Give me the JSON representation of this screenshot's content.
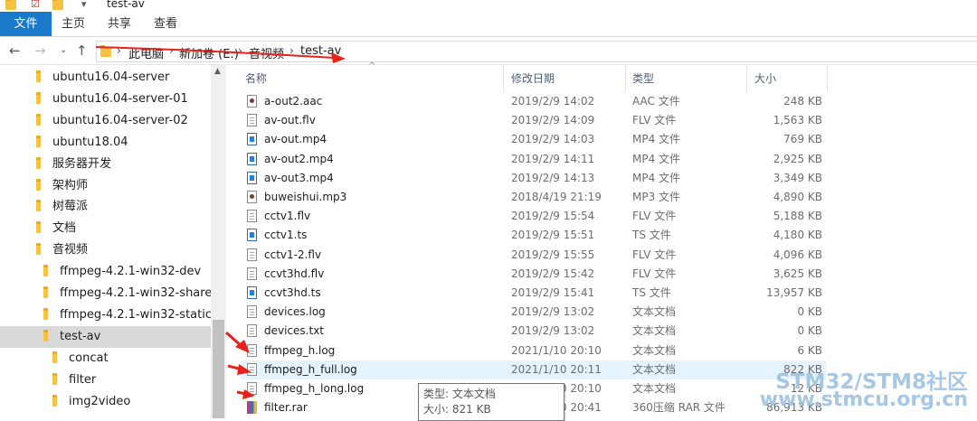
{
  "window": {
    "title": "test-av"
  },
  "ribbon": {
    "tabs": [
      "文件",
      "主页",
      "共享",
      "查看"
    ],
    "active": 0,
    "accent": "#1979ca"
  },
  "nav": {
    "back_icon": "arrow-left-icon",
    "forward_icon": "arrow-right-icon",
    "recent_icon": "chevron-down-icon",
    "up_icon": "arrow-up-icon"
  },
  "address": {
    "crumbs": [
      "此电脑",
      "新加卷 (E:)",
      "音视频",
      "test-av"
    ]
  },
  "sidebar": {
    "items": [
      {
        "label": "ubuntu16.04-server"
      },
      {
        "label": "ubuntu16.04-server-01"
      },
      {
        "label": "ubuntu16.04-server-02"
      },
      {
        "label": "ubuntu18.04"
      },
      {
        "label": "服务器开发"
      },
      {
        "label": "架构师"
      },
      {
        "label": "树莓派"
      },
      {
        "label": "文档"
      },
      {
        "label": "音视频"
      },
      {
        "label": "ffmpeg-4.2.1-win32-dev"
      },
      {
        "label": "ffmpeg-4.2.1-win32-shared"
      },
      {
        "label": "ffmpeg-4.2.1-win32-static"
      },
      {
        "label": "test-av"
      },
      {
        "label": "concat"
      },
      {
        "label": "filter"
      },
      {
        "label": "img2video"
      }
    ],
    "selected": 12
  },
  "columns": {
    "name": "名称",
    "date": "修改日期",
    "type": "类型",
    "size": "大小"
  },
  "files": [
    {
      "name": "a-out2.aac",
      "date": "2019/2/9 14:02",
      "type": "AAC 文件",
      "size": "248 KB",
      "icon": "media"
    },
    {
      "name": "av-out.flv",
      "date": "2019/2/9 14:09",
      "type": "FLV 文件",
      "size": "1,563 KB",
      "icon": "text"
    },
    {
      "name": "av-out.mp4",
      "date": "2019/2/9 14:03",
      "type": "MP4 文件",
      "size": "769 KB",
      "icon": "video"
    },
    {
      "name": "av-out2.mp4",
      "date": "2019/2/9 14:11",
      "type": "MP4 文件",
      "size": "2,925 KB",
      "icon": "video"
    },
    {
      "name": "av-out3.mp4",
      "date": "2019/2/9 14:13",
      "type": "MP4 文件",
      "size": "3,349 KB",
      "icon": "video"
    },
    {
      "name": "buweishui.mp3",
      "date": "2018/4/19 21:19",
      "type": "MP3 文件",
      "size": "4,890 KB",
      "icon": "media"
    },
    {
      "name": "cctv1.flv",
      "date": "2019/2/9 15:54",
      "type": "FLV 文件",
      "size": "5,188 KB",
      "icon": "text"
    },
    {
      "name": "cctv1.ts",
      "date": "2019/2/9 15:51",
      "type": "TS 文件",
      "size": "4,180 KB",
      "icon": "video"
    },
    {
      "name": "cctv1-2.flv",
      "date": "2019/2/9 15:55",
      "type": "FLV 文件",
      "size": "4,096 KB",
      "icon": "text"
    },
    {
      "name": "ccvt3hd.flv",
      "date": "2019/2/9 15:42",
      "type": "FLV 文件",
      "size": "3,625 KB",
      "icon": "text"
    },
    {
      "name": "ccvt3hd.ts",
      "date": "2019/2/9 15:41",
      "type": "TS 文件",
      "size": "13,957 KB",
      "icon": "video"
    },
    {
      "name": "devices.log",
      "date": "2019/2/9 13:02",
      "type": "文本文档",
      "size": "0 KB",
      "icon": "text"
    },
    {
      "name": "devices.txt",
      "date": "2019/2/9 13:02",
      "type": "文本文档",
      "size": "0 KB",
      "icon": "text"
    },
    {
      "name": "ffmpeg_h.log",
      "date": "2021/1/10 20:10",
      "type": "文本文档",
      "size": "6 KB",
      "icon": "text"
    },
    {
      "name": "ffmpeg_h_full.log",
      "date": "2021/1/10 20:11",
      "type": "文本文档",
      "size": "822 KB",
      "icon": "text"
    },
    {
      "name": "ffmpeg_h_long.log",
      "date": "2021/1/10 20:10",
      "type": "文本文档",
      "size": "12 KB",
      "icon": "text"
    },
    {
      "name": "filter.rar",
      "date": "2021/1/10 20:41",
      "type": "360压缩 RAR 文件",
      "size": "86,913 KB",
      "icon": "rar"
    }
  ],
  "hovered_row": 14,
  "tooltip": {
    "type_line": "类型: 文本文档",
    "size_line": "大小: 821 KB"
  },
  "watermark": {
    "line1": "STM32/STM8社区",
    "line2": "www.stmcu.org.cn"
  },
  "annotation_color": "#e8221b"
}
